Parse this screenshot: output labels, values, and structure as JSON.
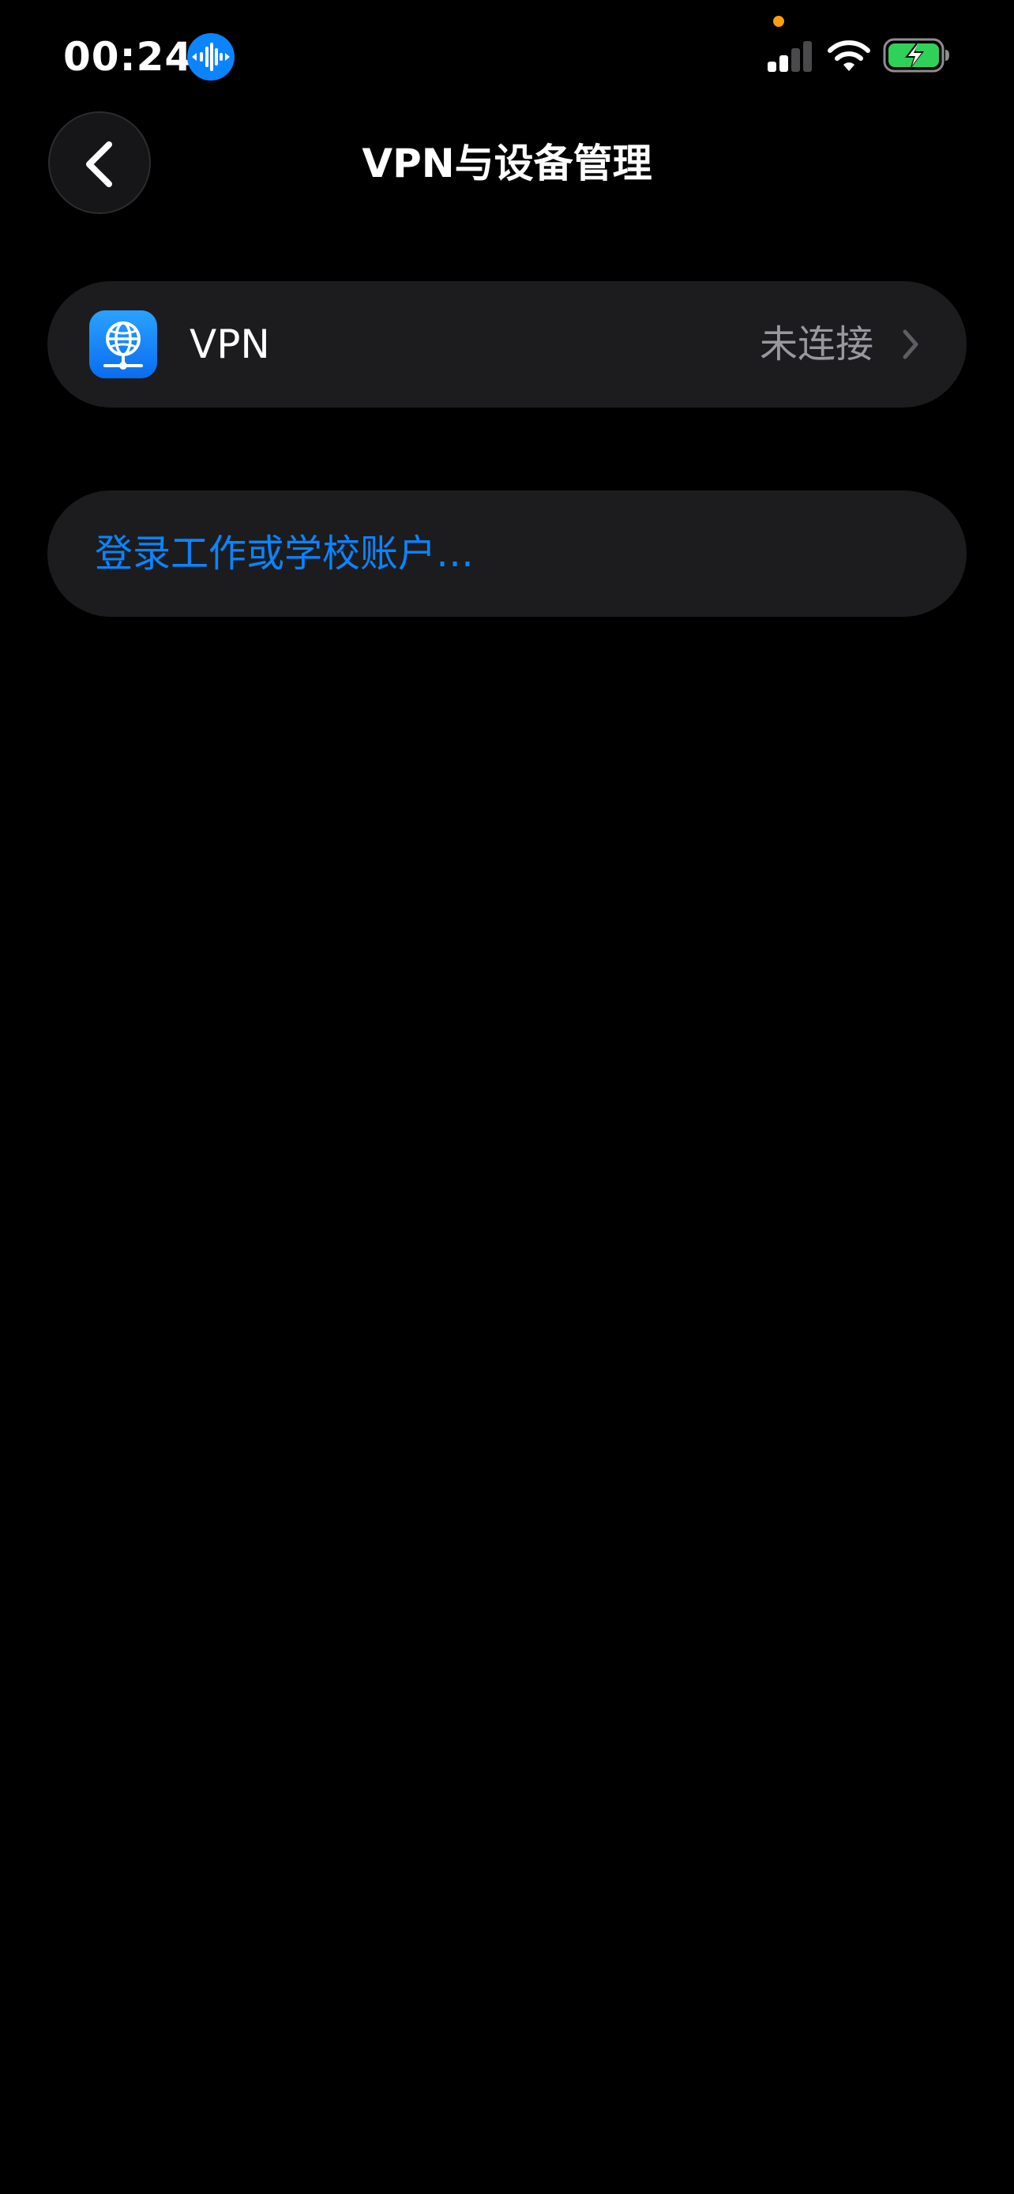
{
  "status_bar": {
    "time": "00:24",
    "siri_icon": "waveform-icon",
    "signal_icon": "cellular-signal-icon",
    "wifi_icon": "wifi-icon",
    "battery_icon": "battery-charging-icon",
    "signal_bars_active": 2,
    "signal_bars_total": 4,
    "battery_color": "#30d158",
    "privacy_dot_color": "#ff9f0a"
  },
  "nav": {
    "back_icon": "chevron-left-icon",
    "title": "VPN与设备管理"
  },
  "vpn_row": {
    "icon": "globe-network-icon",
    "label": "VPN",
    "status": "未连接",
    "chevron": "chevron-right-icon"
  },
  "account_row": {
    "label": "登录工作或学校账户…"
  },
  "colors": {
    "background": "#000000",
    "group_background": "#1c1c1e",
    "accent": "#0a84ff",
    "secondary_text": "#98989e"
  }
}
